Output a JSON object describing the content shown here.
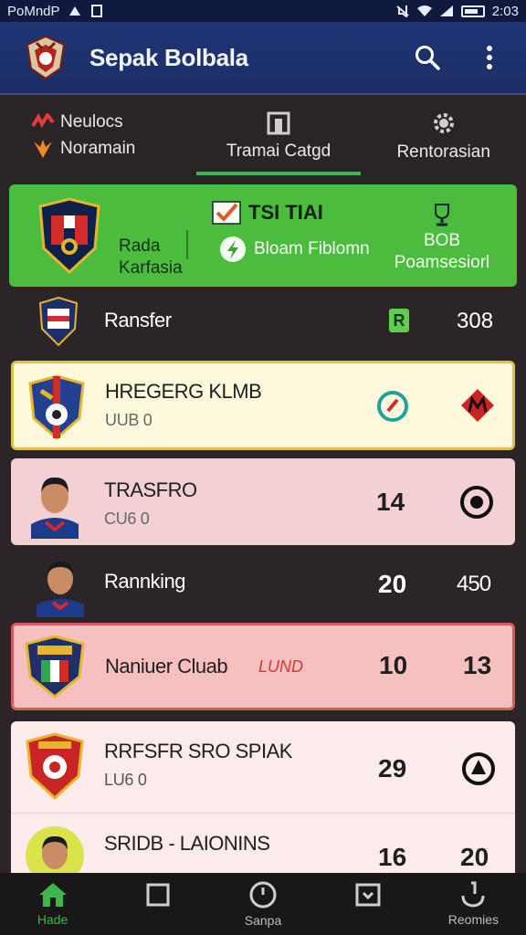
{
  "status_bar": {
    "carrier": "PoMndP",
    "time": "2:03"
  },
  "app_bar": {
    "title": "Sepak Bolbala"
  },
  "tabs": [
    {
      "label": "Neulocs",
      "sub": "Noramain"
    },
    {
      "label": "Tramai Catgd",
      "active": true
    },
    {
      "label": "Rentorasian"
    }
  ],
  "featured": {
    "left_line1": "Rada",
    "left_line2": "Karfasia",
    "title": "TSI TIAI",
    "status": "Bloam Fiblomn",
    "right_line1": "BOB",
    "right_line2": "Poamsesiorl",
    "accent": "#4cbc3f"
  },
  "rows": [
    {
      "name": "Ransfer",
      "badge": "R",
      "value": "308"
    },
    {
      "name": "HREGERG KLMB",
      "sub": "UUB 0"
    },
    {
      "name": "TRASFRO",
      "sub": "CU6 0",
      "value": "14"
    },
    {
      "name": "Rannking",
      "value": "20",
      "value2": "450"
    },
    {
      "name": "Naniuer Cluab",
      "tag": "LUND",
      "value": "10",
      "value2": "13"
    },
    {
      "name": "RRFSFR SRO SPIAK",
      "sub": "LU6 0",
      "value": "29"
    },
    {
      "name": "SRIDB - LAIONINS",
      "value": "16",
      "value2": "20"
    }
  ],
  "bottom_nav": [
    {
      "label": "Hade",
      "icon": "home-icon",
      "active": true
    },
    {
      "label": "",
      "icon": "square-icon"
    },
    {
      "label": "Sanpa",
      "icon": "clock-icon"
    },
    {
      "label": "",
      "icon": "inbox-icon"
    },
    {
      "label": "Reomies",
      "icon": "trophy-icon"
    }
  ]
}
